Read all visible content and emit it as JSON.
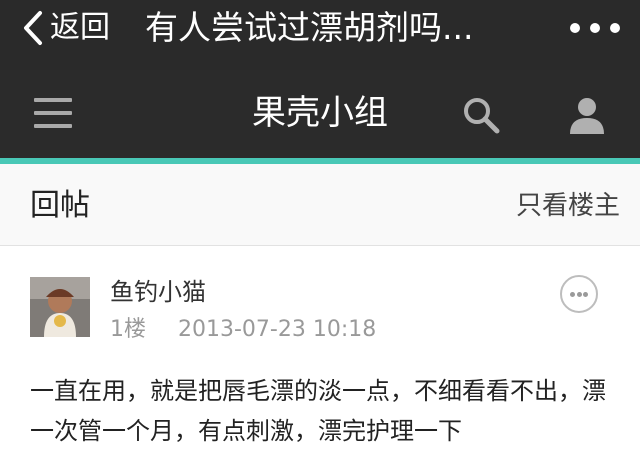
{
  "wechat_bar": {
    "back_label": "返回",
    "title": "有人尝试过漂胡剂吗...",
    "icons": {
      "back": "chevron-left-icon",
      "more": "more-dots-icon"
    }
  },
  "site_header": {
    "title": "果壳小组",
    "icons": {
      "menu": "hamburger-menu-icon",
      "search": "search-icon",
      "user": "user-icon"
    }
  },
  "reply_bar": {
    "title": "回帖",
    "filter_label": "只看楼主"
  },
  "post": {
    "username": "鱼钓小猫",
    "floor": "1楼",
    "timestamp": "2013-07-23 10:18",
    "body": "一直在用，就是把唇毛漂的淡一点，不细看看不出，漂一次管一个月，有点刺激，漂完护理一下"
  },
  "colors": {
    "top_bar": "#2a2a2a",
    "header_bg": "#2b2b2b",
    "accent": "#49c8b6",
    "reply_bar_bg": "#f9f9f9",
    "meta_text": "#999999"
  }
}
